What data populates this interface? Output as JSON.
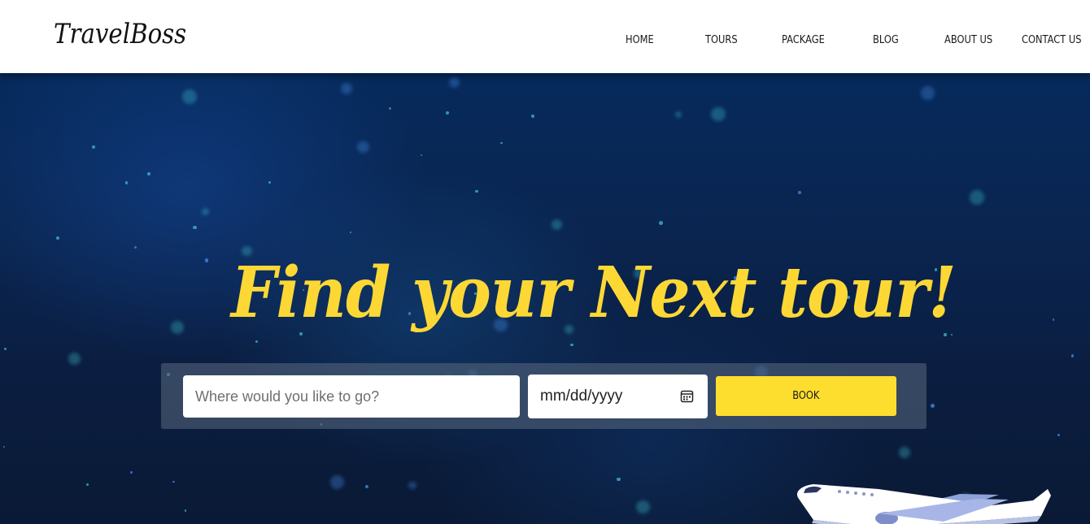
{
  "brand": {
    "logo_text": "TravelBoss"
  },
  "nav": {
    "items": [
      {
        "label": "HOME"
      },
      {
        "label": "TOURS"
      },
      {
        "label": "PACKAGE"
      },
      {
        "label": "BLOG"
      },
      {
        "label": "ABOUT US"
      },
      {
        "label": "CONTACT US"
      }
    ]
  },
  "hero": {
    "title": "Find your Next tour!",
    "search": {
      "destination_placeholder": "Where would you like to go?",
      "date_value": "mm/dd/yyyy",
      "book_label": "BOOK"
    }
  },
  "colors": {
    "accent_yellow": "#fdd835",
    "button_yellow": "#fdde2e",
    "hero_dark_blue": "#0b1d3f",
    "nav_background": "#ffffff"
  },
  "icons": {
    "calendar": "calendar-icon",
    "airplane": "airplane-icon"
  }
}
